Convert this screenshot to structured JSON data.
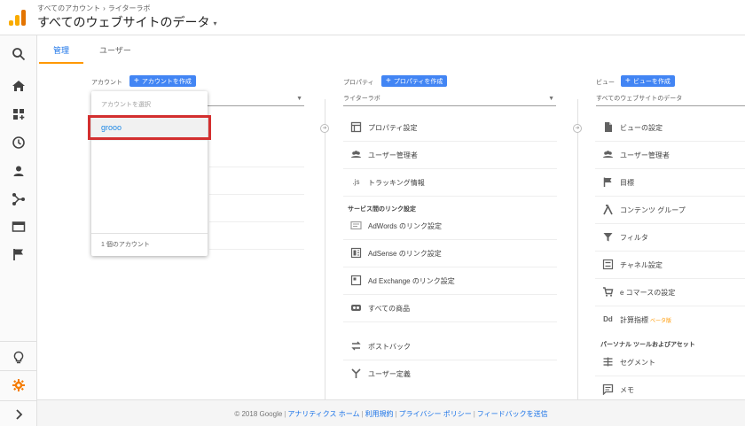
{
  "header": {
    "breadcrumb_root": "すべてのアカウント",
    "breadcrumb_sep": "›",
    "breadcrumb_property": "ライターラボ",
    "view_title": "すべてのウェブサイトのデータ",
    "view_caret": "▾"
  },
  "tabs": [
    {
      "label": "管理"
    },
    {
      "label": "ユーザー"
    }
  ],
  "account": {
    "label": "アカウント",
    "create_label": "アカウントを作成",
    "dropdown": {
      "header": "アカウントを選択",
      "item": "grooo",
      "footer": "1 個のアカウント"
    }
  },
  "property": {
    "label": "プロパティ",
    "create_label": "プロパティを作成",
    "selected": "ライターラボ",
    "items": [
      {
        "label": "プロパティ設定",
        "icon": "square-icon"
      },
      {
        "label": "ユーザー管理者",
        "icon": "people-icon"
      },
      {
        "label": "トラッキング情報",
        "icon": "js-icon",
        "glyph": ".js"
      }
    ],
    "section": "サービス間のリンク設定",
    "link_items": [
      {
        "label": "AdWords のリンク設定",
        "icon": "adwords-icon"
      },
      {
        "label": "AdSense のリンク設定",
        "icon": "adsense-icon"
      },
      {
        "label": "Ad Exchange のリンク設定",
        "icon": "adexchange-icon"
      },
      {
        "label": "すべての商品",
        "icon": "products-icon"
      }
    ],
    "more_items": [
      {
        "label": "ポストバック",
        "icon": "postback-icon"
      },
      {
        "label": "ユーザー定義",
        "icon": "user-defined-icon"
      }
    ]
  },
  "view": {
    "label": "ビュー",
    "create_label": "ビューを作成",
    "selected": "すべてのウェブサイトのデータ",
    "items": [
      {
        "label": "ビューの設定",
        "icon": "document-icon"
      },
      {
        "label": "ユーザー管理者",
        "icon": "people-icon"
      },
      {
        "label": "目標",
        "icon": "flag-icon"
      },
      {
        "label": "コンテンツ グループ",
        "icon": "content-group-icon"
      },
      {
        "label": "フィルタ",
        "icon": "filter-icon"
      },
      {
        "label": "チャネル設定",
        "icon": "channel-icon"
      },
      {
        "label": "e コマースの設定",
        "icon": "cart-icon"
      },
      {
        "label": "計算指標",
        "icon": "dd-icon",
        "glyph": "Dd",
        "badge": "ベータ版"
      }
    ],
    "section": "パーソナル ツールおよびアセット",
    "more_items": [
      {
        "label": "セグメント",
        "icon": "segment-icon"
      },
      {
        "label": "メモ",
        "icon": "memo-icon"
      }
    ]
  },
  "footer": {
    "copyright": "© 2018 Google",
    "links": [
      "アナリティクス ホーム",
      "利用規約",
      "プライバシー ポリシー",
      "フィードバックを送信"
    ]
  },
  "colors": {
    "accent_blue": "#4285f4",
    "tab_underline": "#ff9800",
    "highlight_red": "#d32f2f",
    "gear_orange": "#f57c00",
    "link_blue": "#1a73e8"
  }
}
